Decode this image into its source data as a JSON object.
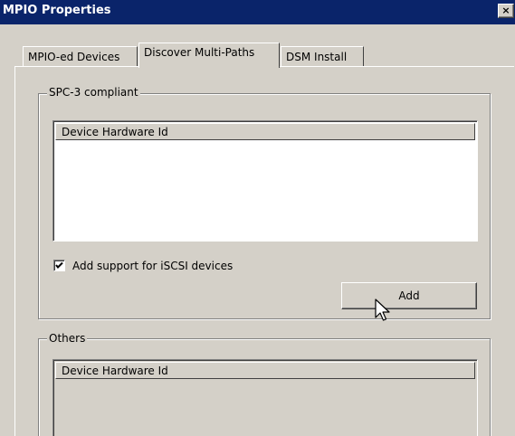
{
  "window": {
    "title": "MPIO Properties",
    "close_glyph": "×"
  },
  "tabs": [
    {
      "label": "MPIO-ed Devices",
      "active": false
    },
    {
      "label": "Discover Multi-Paths",
      "active": true
    },
    {
      "label": "DSM Install",
      "active": false
    }
  ],
  "spc3_group": {
    "label": "SPC-3 compliant",
    "column_header": "Device Hardware Id",
    "rows": [],
    "iscsi_checkbox": {
      "label": "Add support for iSCSI devices",
      "checked": true
    },
    "add_button": "Add"
  },
  "others_group": {
    "label": "Others",
    "column_header": "Device Hardware Id",
    "rows": []
  },
  "icons": {
    "cursor": "arrow-cursor-icon"
  },
  "colors": {
    "titlebar": "#0a246a",
    "face": "#d4d0c8"
  }
}
